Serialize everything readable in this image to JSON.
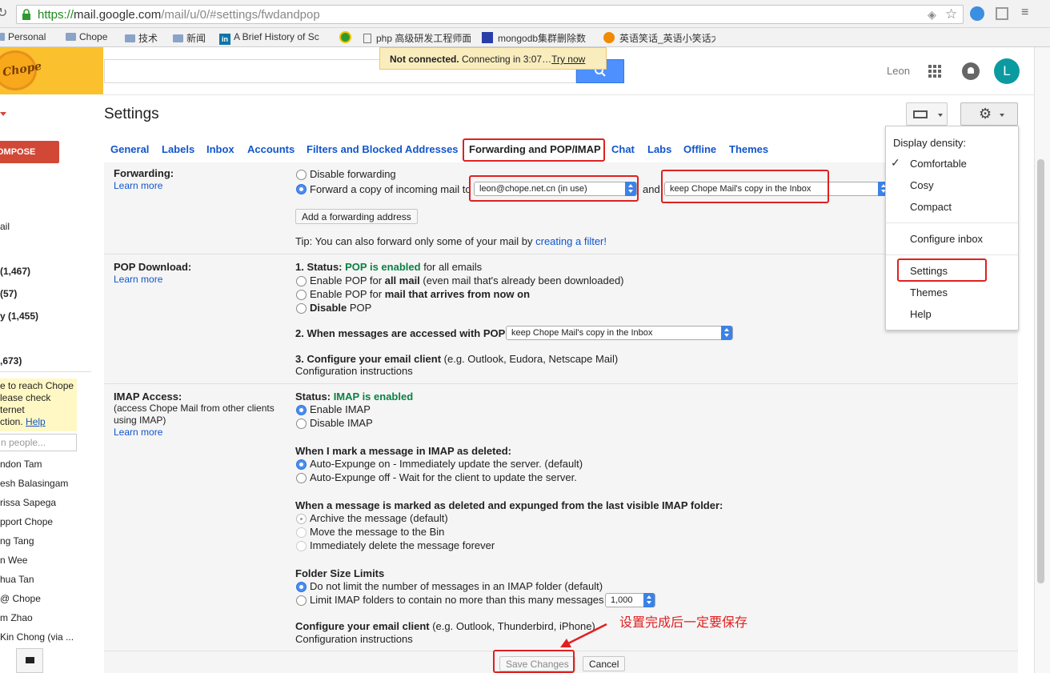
{
  "browser": {
    "url_scheme": "https://",
    "url_host": "mail.google.com",
    "url_path": "/mail/u/0/#settings/fwdandpop",
    "bookmarks": [
      "Personal",
      "Chope",
      "技术",
      "新闻",
      "A Brief History of Sc",
      "php 高级研发工程师面",
      "mongodb集群删除数",
      "英语笑话_英语小笑话大"
    ]
  },
  "notice": {
    "title": "Not connected.",
    "text": "Connecting in 3:07…",
    "action": "Try now"
  },
  "header": {
    "user_name": "Leon",
    "avatar_letter": "L"
  },
  "sidebar": {
    "compose": "OMPOSE",
    "items": [
      "ail",
      "(1,467)",
      "(57)",
      "y (1,455)",
      ",673)"
    ],
    "hangout_warning": [
      "e to reach Chope",
      "lease check",
      "ternet",
      "ction."
    ],
    "hangout_help": "Help",
    "people_search_placeholder": "n people...",
    "contacts": [
      "ndon Tam",
      "esh Balasingam",
      "rissa Sapega",
      "pport Chope",
      "ng Tang",
      "n Wee",
      "hua Tan",
      "@ Chope",
      "m Zhao",
      "Kin Chong (via ..."
    ]
  },
  "settings": {
    "title": "Settings",
    "tabs": [
      "General",
      "Labels",
      "Inbox",
      "Accounts",
      "Filters and Blocked Addresses",
      "Forwarding and POP/IMAP",
      "Chat",
      "Labs",
      "Offline",
      "Themes"
    ],
    "learn_more": "Learn more",
    "forwarding": {
      "label": "Forwarding:",
      "disable": "Disable forwarding",
      "forward_copy": "Forward a copy of incoming mail to",
      "forward_address": "leon@chope.net.cn (in use)",
      "and": "and",
      "forward_action": "keep Chope Mail's copy in the Inbox",
      "add_button": "Add a forwarding address",
      "tip": "Tip: You can also forward only some of your mail by",
      "tip_link": "creating a filter!"
    },
    "pop": {
      "label": "POP Download:",
      "status_prefix": "1. Status:",
      "status_value": "POP is enabled",
      "status_suffix": "for all emails",
      "opt1_a": "Enable POP for",
      "opt1_b": "all mail",
      "opt1_c": "(even mail that's already been downloaded)",
      "opt2_a": "Enable POP for",
      "opt2_b": "mail that arrives from now on",
      "opt3": "Disable",
      "opt3_b": "POP",
      "accessed_label": "2. When messages are accessed with POP",
      "accessed_value": "keep Chope Mail's copy in the Inbox",
      "configure_label": "3. Configure your email client",
      "configure_hint": "(e.g. Outlook, Eudora, Netscape Mail)",
      "configure_link": "Configuration instructions"
    },
    "imap": {
      "label": "IMAP Access:",
      "sublabel": [
        "(access Chope Mail from other clients",
        "using IMAP)"
      ],
      "status_prefix": "Status:",
      "status_value": "IMAP is enabled",
      "enable": "Enable IMAP",
      "disable": "Disable IMAP",
      "deleted_label": "When I mark a message in IMAP as deleted:",
      "expunge_on": "Auto-Expunge on - Immediately update the server. (default)",
      "expunge_off": "Auto-Expunge off - Wait for the client to update the server.",
      "expunged_label": "When a message is marked as deleted and expunged from the last visible IMAP folder:",
      "archive": "Archive the message (default)",
      "bin": "Move the message to the Bin",
      "delete_forever": "Immediately delete the message forever",
      "folder_label": "Folder Size Limits",
      "no_limit": "Do not limit the number of messages in an IMAP folder (default)",
      "limit": "Limit IMAP folders to contain no more than this many messages",
      "limit_value": "1,000",
      "configure_label": "Configure your email client",
      "configure_hint": "(e.g. Outlook, Thunderbird, iPhone)",
      "configure_link": "Configuration instructions"
    },
    "save": "Save Changes",
    "cancel": "Cancel"
  },
  "menu": {
    "density_label": "Display density:",
    "density": [
      "Comfortable",
      "Cosy",
      "Compact"
    ],
    "configure_inbox": "Configure inbox",
    "settings": "Settings",
    "themes": "Themes",
    "help": "Help"
  },
  "annotation": "设置完成后一定要保存",
  "colors": {
    "accent": "#1155cc",
    "highlight": "#e02020",
    "compose": "#d14836",
    "enabled": "#0b8043"
  }
}
